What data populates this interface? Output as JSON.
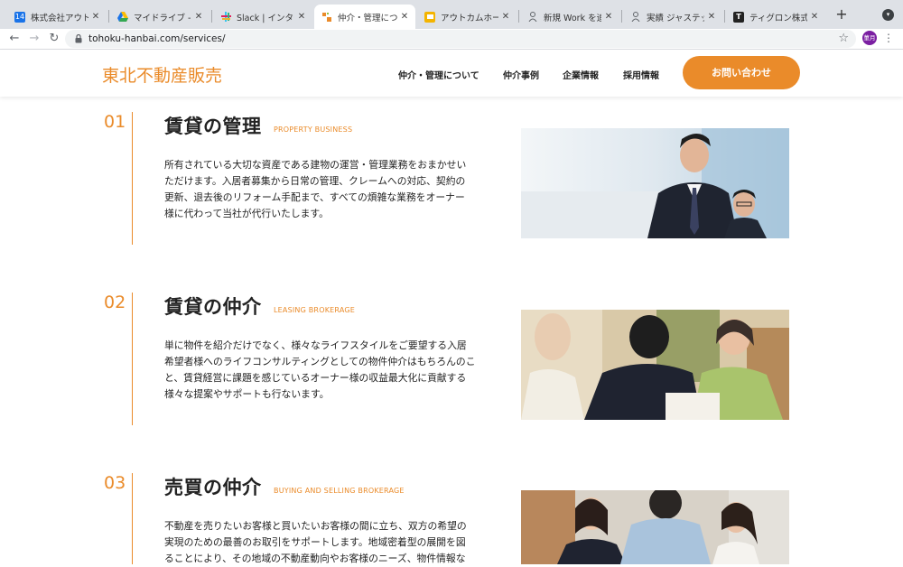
{
  "browser": {
    "tabs": [
      {
        "title": "株式会社アウトカム",
        "favicon": "calendar-icon",
        "color": "#1a73e8"
      },
      {
        "title": "マイドライブ - Goo",
        "favicon": "drive-icon",
        "color": "#34a853"
      },
      {
        "title": "Slack | インターン",
        "favicon": "slack-icon",
        "color": "#e01e5a"
      },
      {
        "title": "仲介・管理について",
        "favicon": "site-icon",
        "color": "#ea8b2a",
        "active": true
      },
      {
        "title": "アウトカムホームペ",
        "favicon": "slides-icon",
        "color": "#f4b400"
      },
      {
        "title": "新規 Work を追加",
        "favicon": "person-icon",
        "color": "#5f6368"
      },
      {
        "title": "実績 ジャステック様",
        "favicon": "person-icon",
        "color": "#5f6368"
      },
      {
        "title": "ティグロン株式会社",
        "favicon": "t-icon",
        "color": "#222222"
      }
    ],
    "url": "tohoku-hanbai.com/services/",
    "profile_label": "菫月"
  },
  "site": {
    "logo": "東北不動産販売",
    "nav": [
      "仲介・管理について",
      "仲介事例",
      "企業情報",
      "採用情報"
    ],
    "cta": "お問い合わせ",
    "accent": "#ea8b2a"
  },
  "sections": [
    {
      "num": "01",
      "title": "賃貸の管理",
      "subtitle": "PROPERTY BUSINESS",
      "body_lines": [
        "所有されている大切な資産である建物の運営・管理業務をおまかせい",
        "ただけます。入居者募集から日常の管理、クレームへの対応、契約の",
        "更新、退去後のリフォーム手配まで、すべての煩雑な業務をオーナー",
        "様に代わって当社が代行いたします。"
      ]
    },
    {
      "num": "02",
      "title": "賃貸の仲介",
      "subtitle": "LEASING BROKERAGE",
      "body_lines": [
        "単に物件を紹介だけでなく、様々なライフスタイルをご要望する入居",
        "希望者様へのライフコンサルティングとしての物件仲介はもちろんのこ",
        "と、賃貸経営に課題を感じているオーナー様の収益最大化に貢献する",
        "様々な提案やサポートも行ないます。"
      ]
    },
    {
      "num": "03",
      "title": "売買の仲介",
      "subtitle": "BUYING AND SELLING BROKERAGE",
      "body_lines": [
        "不動産を売りたいお客様と買いたいお客様の間に立ち、双方の希望の",
        "実現のための最善のお取引をサポートします。地域密着型の展開を図",
        "ることにより、その地域の不動産動向やお客様のニーズ、物件情報な"
      ]
    }
  ]
}
